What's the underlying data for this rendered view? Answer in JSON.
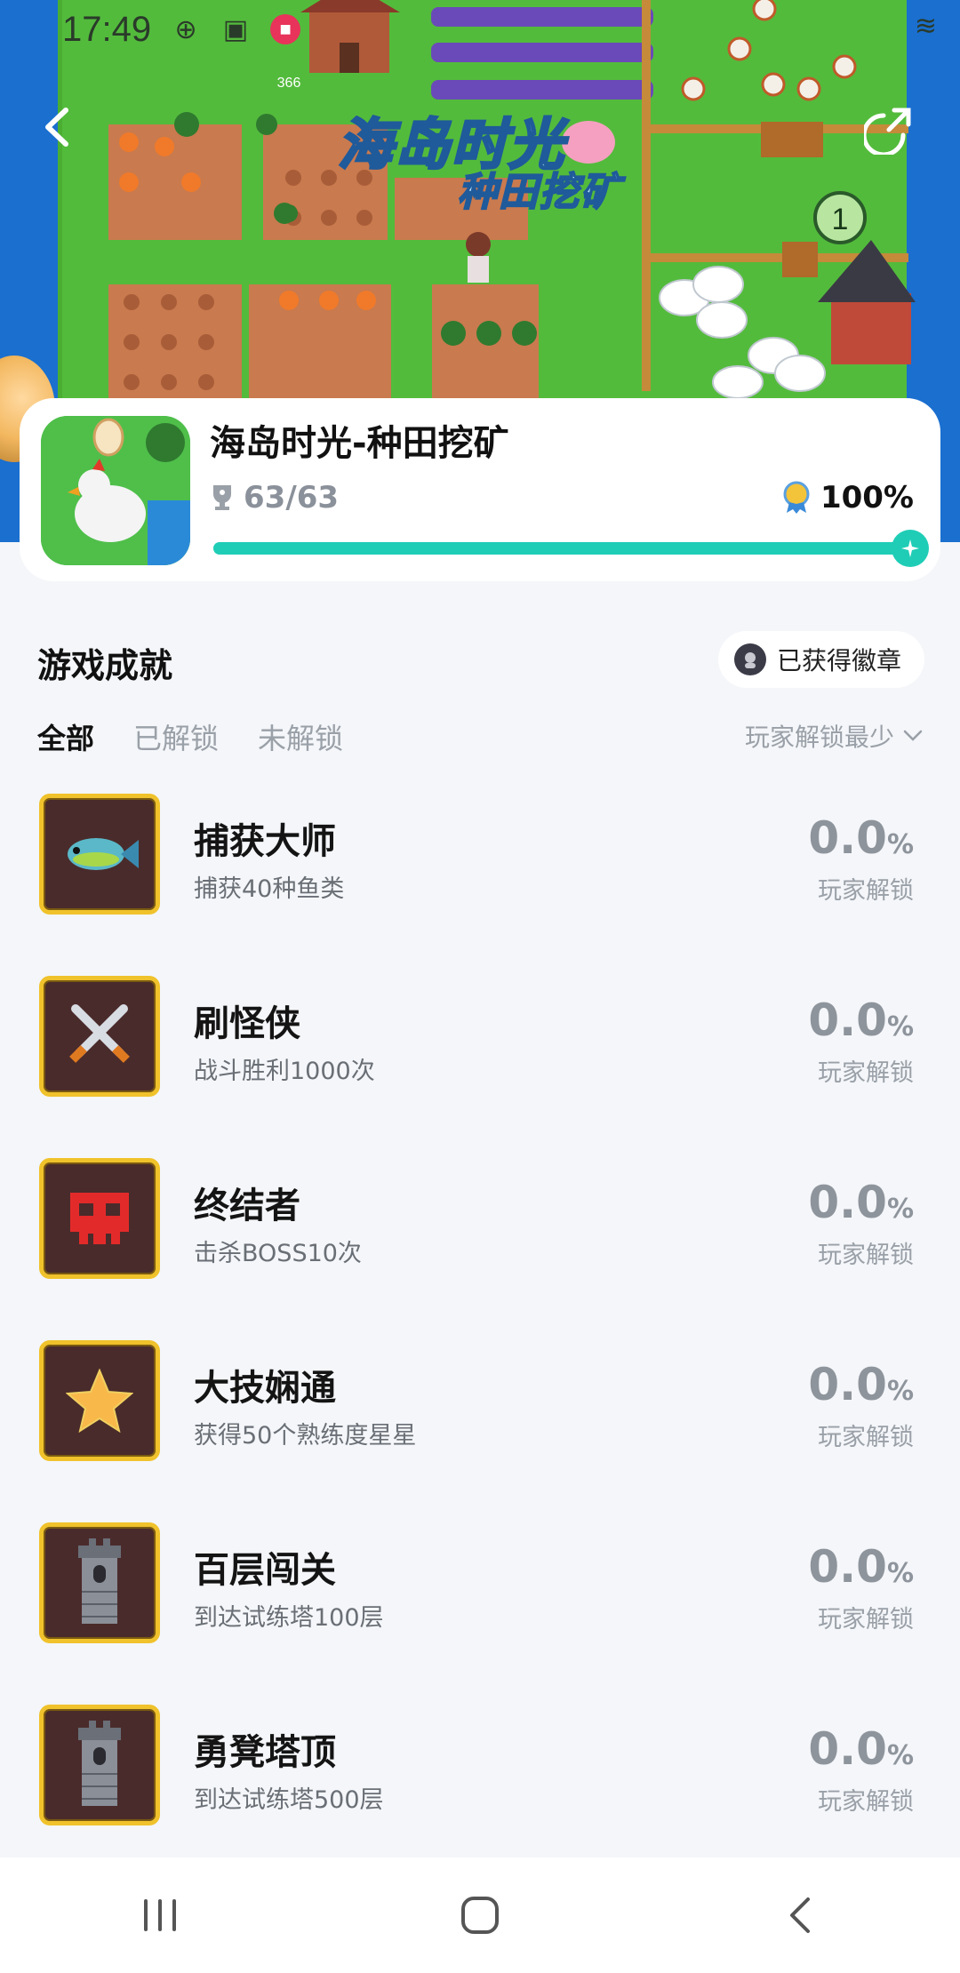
{
  "status_bar": {
    "time": "17:49"
  },
  "hero": {
    "title": "海岛时光",
    "subtitle": "种田挖矿",
    "badge_number": "1",
    "level_tag": "366"
  },
  "game": {
    "name": "海岛时光-种田挖矿",
    "trophy_count": "63/63",
    "completion": "100%",
    "progress": 1.0
  },
  "section": {
    "title": "游戏成就",
    "badge_button": "已获得徽章"
  },
  "tabs": [
    {
      "label": "全部",
      "active": true
    },
    {
      "label": "已解锁",
      "active": false
    },
    {
      "label": "未解锁",
      "active": false
    }
  ],
  "sort": {
    "label": "玩家解锁最少"
  },
  "achievements": [
    {
      "name": "捕获大师",
      "desc": "捕获40种鱼类",
      "pct": "0.0",
      "unit": "%",
      "label": "玩家解锁",
      "icon": "fish-icon"
    },
    {
      "name": "刷怪侠",
      "desc": "战斗胜利1000次",
      "pct": "0.0",
      "unit": "%",
      "label": "玩家解锁",
      "icon": "crossed-swords-icon"
    },
    {
      "name": "终结者",
      "desc": "击杀BOSS10次",
      "pct": "0.0",
      "unit": "%",
      "label": "玩家解锁",
      "icon": "skull-icon"
    },
    {
      "name": "大技娴通",
      "desc": "获得50个熟练度星星",
      "pct": "0.0",
      "unit": "%",
      "label": "玩家解锁",
      "icon": "star-icon"
    },
    {
      "name": "百层闯关",
      "desc": "到达试练塔100层",
      "pct": "0.0",
      "unit": "%",
      "label": "玩家解锁",
      "icon": "tower-icon"
    },
    {
      "name": "勇凳塔顶",
      "desc": "到达试练塔500层",
      "pct": "0.0",
      "unit": "%",
      "label": "玩家解锁",
      "icon": "tower-icon"
    }
  ],
  "colors": {
    "accent": "#1fcdb6",
    "badge_border": "#f0c22b",
    "badge_bg": "#4a2b2b",
    "background": "#f4f6f9"
  }
}
